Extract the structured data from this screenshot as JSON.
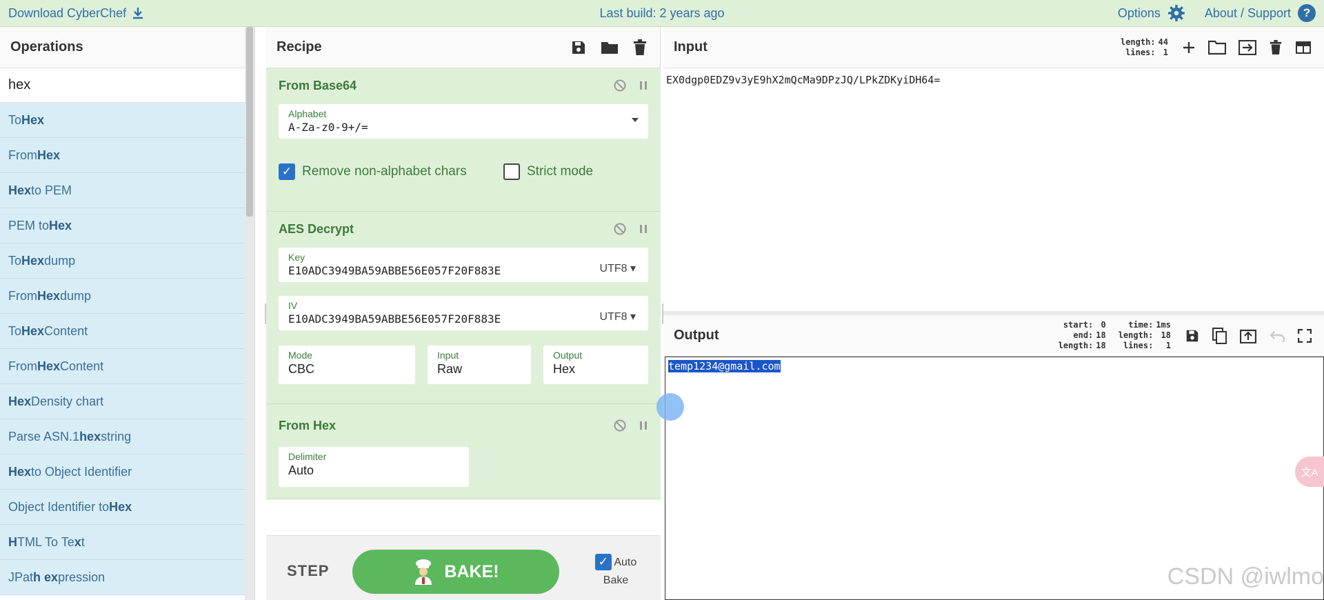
{
  "banner": {
    "download": "Download CyberChef",
    "last_build": "Last build: 2 years ago",
    "options": "Options",
    "about": "About / Support",
    "about_q": "?"
  },
  "operations": {
    "title": "Operations",
    "search_value": "hex",
    "items": [
      {
        "pre": "To ",
        "hl": "Hex",
        "post": ""
      },
      {
        "pre": "From ",
        "hl": "Hex",
        "post": ""
      },
      {
        "pre": "",
        "hl": "Hex",
        "post": " to PEM"
      },
      {
        "pre": "PEM to ",
        "hl": "Hex",
        "post": ""
      },
      {
        "pre": "To ",
        "hl": "Hex",
        "post": "dump"
      },
      {
        "pre": "From ",
        "hl": "Hex",
        "post": "dump"
      },
      {
        "pre": "To ",
        "hl": "Hex",
        "post": " Content"
      },
      {
        "pre": "From ",
        "hl": "Hex",
        "post": " Content"
      },
      {
        "pre": "",
        "hl": "Hex",
        "post": " Density chart"
      },
      {
        "pre": "Parse ASN.1 ",
        "hl": "hex",
        "post": " string"
      },
      {
        "pre": "",
        "hl": "Hex",
        "post": " to Object Identifier"
      },
      {
        "pre": "Object Identifier to ",
        "hl": "Hex",
        "post": ""
      },
      {
        "pre": "",
        "hl": "H",
        "post": "TML To Te",
        "hl2": "x",
        "post2": "t"
      },
      {
        "pre": "JPat",
        "hl": "h ex",
        "post": "pression"
      }
    ]
  },
  "recipe": {
    "title": "Recipe",
    "from_base64": {
      "title": "From Base64",
      "alphabet_label": "Alphabet",
      "alphabet_value": "A-Za-z0-9+/=",
      "remove_label": "Remove non-alphabet chars",
      "strict_label": "Strict mode"
    },
    "aes": {
      "title": "AES Decrypt",
      "key_label": "Key",
      "key_value": "E10ADC3949BA59ABBE56E057F20F883E",
      "key_enc": "UTF8",
      "iv_label": "IV",
      "iv_value": "E10ADC3949BA59ABBE56E057F20F883E",
      "iv_enc": "UTF8",
      "mode_label": "Mode",
      "mode_value": "CBC",
      "input_label": "Input",
      "input_value": "Raw",
      "output_label": "Output",
      "output_value": "Hex"
    },
    "from_hex": {
      "title": "From Hex",
      "delim_label": "Delimiter",
      "delim_value": "Auto"
    },
    "step": "STEP",
    "bake": "BAKE!",
    "auto_bake": "Auto Bake"
  },
  "input": {
    "title": "Input",
    "length_label": "length:",
    "length": "44",
    "lines_label": "lines:",
    "lines": "1",
    "text": "EX0dgp0EDZ9v3yE9hX2mQcMa9DPzJQ/LPkZDKyiDH64="
  },
  "output": {
    "title": "Output",
    "start_label": "start:",
    "start": "0",
    "end_label": "end:",
    "end": "18",
    "sel_length_label": "length:",
    "sel_length": "18",
    "time_label": "time:",
    "time": "1ms",
    "length_label": "length:",
    "length": "18",
    "lines_label": "lines:",
    "lines": "1",
    "text": "temp1234@gmail.com"
  },
  "watermark": "CSDN @iwlmo",
  "translate_badge": "文A",
  "colors": {
    "banner_bg": "#dff0d8",
    "op_bg": "#d9edf7",
    "bake_green": "#5cb85c",
    "selection": "#1a56c8"
  }
}
